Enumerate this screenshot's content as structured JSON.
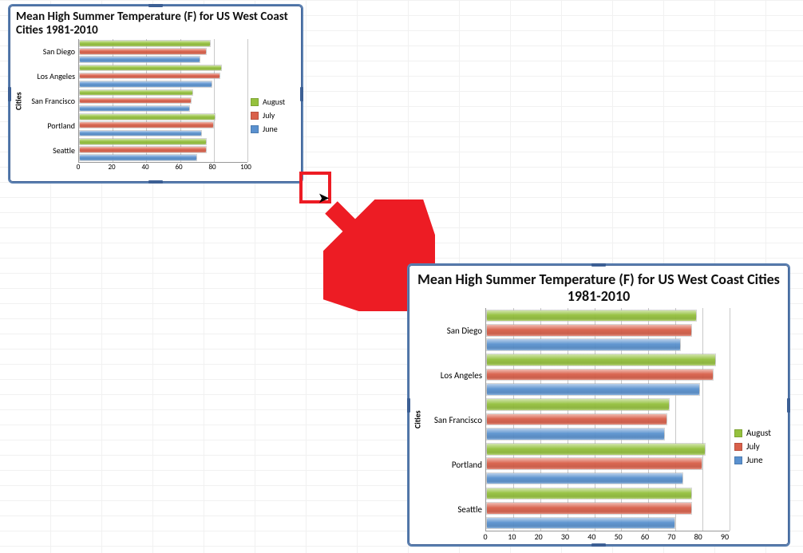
{
  "chart_data": [
    {
      "type": "bar",
      "orientation": "horizontal",
      "title": "Mean High Summer Temperature (F) for US West Coast Cities 1981-2010",
      "ylabel": "Cities",
      "xlabel": "",
      "xlim": [
        0,
        100
      ],
      "xticks": [
        0,
        20,
        40,
        60,
        80,
        100
      ],
      "categories": [
        "San Diego",
        "Los Angeles",
        "San Francisco",
        "Portland",
        "Seattle"
      ],
      "series": [
        {
          "name": "August",
          "values": [
            78,
            85,
            68,
            81,
            76
          ],
          "color": "#95c13d"
        },
        {
          "name": "July",
          "values": [
            76,
            84,
            67,
            80,
            76
          ],
          "color": "#d9604a"
        },
        {
          "name": "June",
          "values": [
            72,
            79,
            66,
            73,
            70
          ],
          "color": "#5a91cf"
        }
      ],
      "legend_position": "right"
    },
    {
      "type": "bar",
      "orientation": "horizontal",
      "title": "Mean High Summer Temperature (F) for US West Coast Cities 1981-2010",
      "ylabel": "Cities",
      "xlabel": "",
      "xlim": [
        0,
        90
      ],
      "xticks": [
        0,
        10,
        20,
        30,
        40,
        50,
        60,
        70,
        80,
        90
      ],
      "categories": [
        "San Diego",
        "Los Angeles",
        "San Francisco",
        "Portland",
        "Seattle"
      ],
      "series": [
        {
          "name": "August",
          "values": [
            78,
            85,
            68,
            81,
            76
          ],
          "color": "#95c13d"
        },
        {
          "name": "July",
          "values": [
            76,
            84,
            67,
            80,
            76
          ],
          "color": "#d9604a"
        },
        {
          "name": "June",
          "values": [
            72,
            79,
            66,
            73,
            70
          ],
          "color": "#5a91cf"
        }
      ],
      "legend_position": "right"
    }
  ],
  "annotation": {
    "description": "Drag-to-resize indicator from small chart corner to enlarged chart",
    "marker_color": "#ed1c24"
  }
}
